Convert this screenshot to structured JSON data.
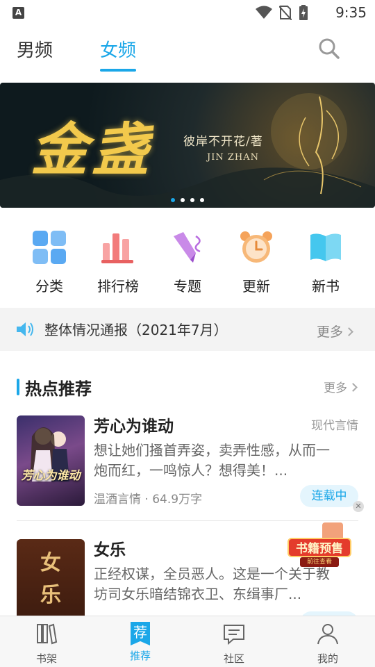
{
  "status_bar": {
    "time": "9:35"
  },
  "top_tabs": {
    "male": "男频",
    "female": "女频",
    "active": "女频"
  },
  "banner": {
    "title_calligraphy": "金盏",
    "author": "彼岸不开花/著",
    "pinyin": "JIN ZHAN",
    "slides": 4,
    "active_slide": 1
  },
  "categories": [
    {
      "label": "分类",
      "icon": "grid-icon",
      "color": "#5aa9f2"
    },
    {
      "label": "排行榜",
      "icon": "bar-chart-icon",
      "color": "#f27b7b"
    },
    {
      "label": "专题",
      "icon": "pen-icon",
      "color": "#b86be0"
    },
    {
      "label": "更新",
      "icon": "alarm-clock-icon",
      "color": "#f5a35a"
    },
    {
      "label": "新书",
      "icon": "book-icon",
      "color": "#45c7ee"
    }
  ],
  "notice": {
    "text": "整体情况通报（2021年7月）",
    "more": "更多"
  },
  "hot_section": {
    "title": "热点推荐",
    "more": "更多"
  },
  "books": [
    {
      "title": "芳心为谁动",
      "genre": "现代言情",
      "desc": "想让她们搔首弄姿，卖弄性感，从而一炮而红，一鸣惊人？想得美！...",
      "meta": "温酒言情 · 64.9万字",
      "status": "连载中",
      "cover_text": "芳心为谁动"
    },
    {
      "title": "女乐",
      "genre": "",
      "desc": "正经权谋，全员恶人。这是一个关于教坊司女乐暗结锦衣卫、东缉事厂...",
      "meta": "",
      "status": "",
      "cover_text": "女乐"
    }
  ],
  "presale_badge": {
    "main": "书籍预售",
    "sub": "前往查看"
  },
  "bottom_nav": [
    {
      "label": "书架",
      "icon": "bookshelf-icon"
    },
    {
      "label": "推荐",
      "icon": "recommend-icon",
      "icon_text": "荐"
    },
    {
      "label": "社区",
      "icon": "chat-icon"
    },
    {
      "label": "我的",
      "icon": "user-icon"
    }
  ],
  "colors": {
    "accent": "#1ba7e8",
    "notice_bg": "#f3f3f3",
    "status_pill_bg": "#e4f5fd"
  }
}
